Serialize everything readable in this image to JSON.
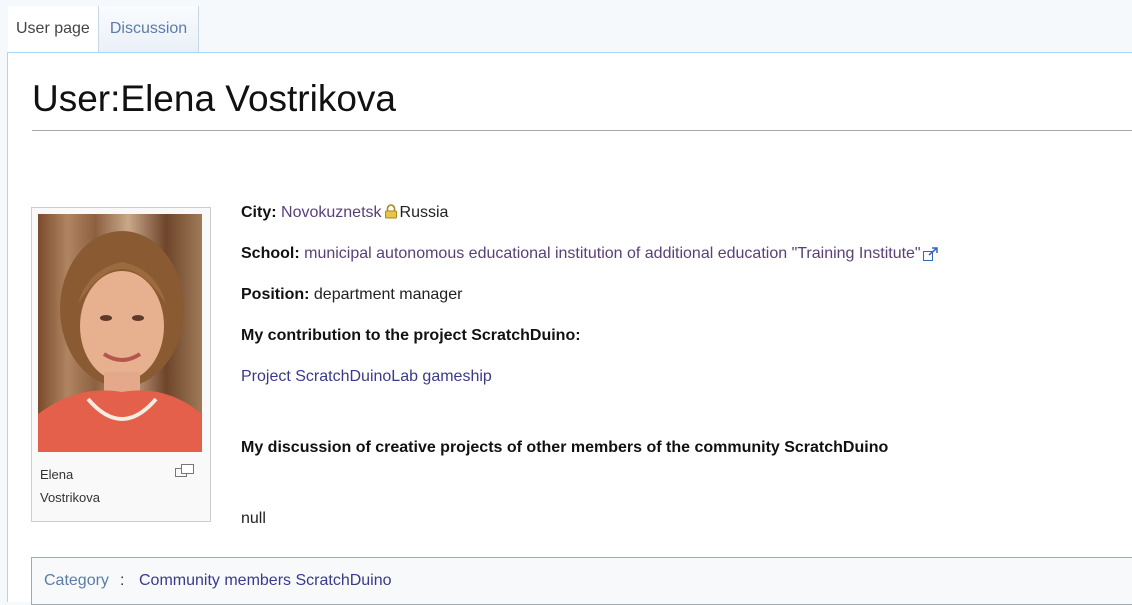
{
  "tabs": [
    {
      "label": "User page",
      "active": true
    },
    {
      "label": "Discussion",
      "active": false
    }
  ],
  "page_title": "User:Elena Vostrikova",
  "image": {
    "caption_line1": "Elena",
    "caption_line2": "Vostrikova",
    "icon": "magnify-icon"
  },
  "info": {
    "city_label": "City:",
    "city_link": "Novokuznetsk",
    "country": "Russia",
    "school_label": "School:",
    "school_link": "municipal autonomous educational institution of additional education \"Training Institute\"",
    "position_label": "Position:",
    "position_value": "department manager",
    "contribution_heading": "My contribution to the project ScratchDuino:",
    "project_link": "Project ScratchDuinoLab gameship",
    "discussion_heading": "My discussion of creative projects of other members of the community ScratchDuino",
    "null_text": "null"
  },
  "categories": {
    "label": "Category",
    "separator": ":",
    "items": [
      "Community members ScratchDuino"
    ]
  },
  "colors": {
    "link": "#3a3a8c",
    "tab_link": "#5a7da8",
    "border_blue": "#a7d7f9"
  }
}
